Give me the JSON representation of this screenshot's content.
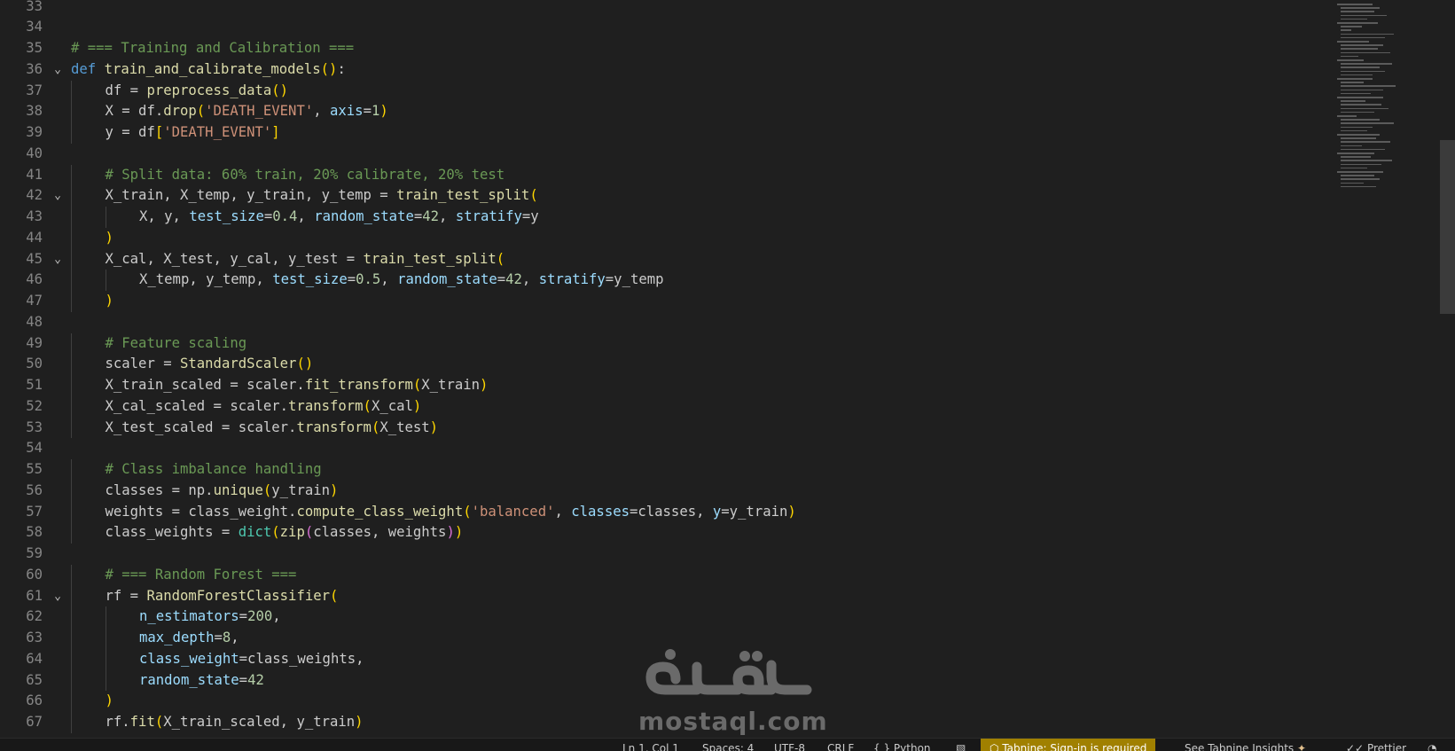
{
  "editor": {
    "lines": [
      {
        "n": "33",
        "fold": false,
        "indent": 0,
        "tokens": []
      },
      {
        "n": "34",
        "fold": false,
        "indent": 0,
        "tokens": []
      },
      {
        "n": "35",
        "fold": false,
        "indent": 0,
        "tokens": [
          [
            "cm",
            "# === Training and Calibration ==="
          ]
        ]
      },
      {
        "n": "36",
        "fold": true,
        "indent": 0,
        "tokens": [
          [
            "kw",
            "def"
          ],
          [
            "def",
            " "
          ],
          [
            "fn",
            "train_and_calibrate_models"
          ],
          [
            "b1",
            "()"
          ],
          [
            "def",
            ":"
          ]
        ]
      },
      {
        "n": "37",
        "fold": false,
        "indent": 1,
        "tokens": [
          [
            "def",
            "df = "
          ],
          [
            "fn",
            "preprocess_data"
          ],
          [
            "b1",
            "()"
          ]
        ]
      },
      {
        "n": "38",
        "fold": false,
        "indent": 1,
        "tokens": [
          [
            "def",
            "X = df."
          ],
          [
            "fn",
            "drop"
          ],
          [
            "b1",
            "("
          ],
          [
            "str",
            "'DEATH_EVENT'"
          ],
          [
            "def",
            ", "
          ],
          [
            "par",
            "axis"
          ],
          [
            "def",
            "="
          ],
          [
            "num",
            "1"
          ],
          [
            "b1",
            ")"
          ]
        ]
      },
      {
        "n": "39",
        "fold": false,
        "indent": 1,
        "tokens": [
          [
            "def",
            "y = df"
          ],
          [
            "b1",
            "["
          ],
          [
            "str",
            "'DEATH_EVENT'"
          ],
          [
            "b1",
            "]"
          ]
        ]
      },
      {
        "n": "40",
        "fold": false,
        "indent": 0,
        "tokens": []
      },
      {
        "n": "41",
        "fold": false,
        "indent": 1,
        "tokens": [
          [
            "cm",
            "# Split data: 60% train, 20% calibrate, 20% test"
          ]
        ]
      },
      {
        "n": "42",
        "fold": true,
        "indent": 1,
        "tokens": [
          [
            "def",
            "X_train, X_temp, y_train, y_temp = "
          ],
          [
            "fn",
            "train_test_split"
          ],
          [
            "b1",
            "("
          ]
        ]
      },
      {
        "n": "43",
        "fold": false,
        "indent": 2,
        "tokens": [
          [
            "def",
            "X, y, "
          ],
          [
            "par",
            "test_size"
          ],
          [
            "def",
            "="
          ],
          [
            "num",
            "0.4"
          ],
          [
            "def",
            ", "
          ],
          [
            "par",
            "random_state"
          ],
          [
            "def",
            "="
          ],
          [
            "num",
            "42"
          ],
          [
            "def",
            ", "
          ],
          [
            "par",
            "stratify"
          ],
          [
            "def",
            "=y"
          ]
        ]
      },
      {
        "n": "44",
        "fold": false,
        "indent": 1,
        "tokens": [
          [
            "b1",
            ")"
          ]
        ]
      },
      {
        "n": "45",
        "fold": true,
        "indent": 1,
        "tokens": [
          [
            "def",
            "X_cal, X_test, y_cal, y_test = "
          ],
          [
            "fn",
            "train_test_split"
          ],
          [
            "b1",
            "("
          ]
        ]
      },
      {
        "n": "46",
        "fold": false,
        "indent": 2,
        "tokens": [
          [
            "def",
            "X_temp, y_temp, "
          ],
          [
            "par",
            "test_size"
          ],
          [
            "def",
            "="
          ],
          [
            "num",
            "0.5"
          ],
          [
            "def",
            ", "
          ],
          [
            "par",
            "random_state"
          ],
          [
            "def",
            "="
          ],
          [
            "num",
            "42"
          ],
          [
            "def",
            ", "
          ],
          [
            "par",
            "stratify"
          ],
          [
            "def",
            "=y_temp"
          ]
        ]
      },
      {
        "n": "47",
        "fold": false,
        "indent": 1,
        "tokens": [
          [
            "b1",
            ")"
          ]
        ]
      },
      {
        "n": "48",
        "fold": false,
        "indent": 0,
        "tokens": []
      },
      {
        "n": "49",
        "fold": false,
        "indent": 1,
        "tokens": [
          [
            "cm",
            "# Feature scaling"
          ]
        ]
      },
      {
        "n": "50",
        "fold": false,
        "indent": 1,
        "tokens": [
          [
            "def",
            "scaler = "
          ],
          [
            "fn",
            "StandardScaler"
          ],
          [
            "b1",
            "()"
          ]
        ]
      },
      {
        "n": "51",
        "fold": false,
        "indent": 1,
        "tokens": [
          [
            "def",
            "X_train_scaled = scaler."
          ],
          [
            "fn",
            "fit_transform"
          ],
          [
            "b1",
            "("
          ],
          [
            "def",
            "X_train"
          ],
          [
            "b1",
            ")"
          ]
        ]
      },
      {
        "n": "52",
        "fold": false,
        "indent": 1,
        "tokens": [
          [
            "def",
            "X_cal_scaled = scaler."
          ],
          [
            "fn",
            "transform"
          ],
          [
            "b1",
            "("
          ],
          [
            "def",
            "X_cal"
          ],
          [
            "b1",
            ")"
          ]
        ]
      },
      {
        "n": "53",
        "fold": false,
        "indent": 1,
        "tokens": [
          [
            "def",
            "X_test_scaled = scaler."
          ],
          [
            "fn",
            "transform"
          ],
          [
            "b1",
            "("
          ],
          [
            "def",
            "X_test"
          ],
          [
            "b1",
            ")"
          ]
        ]
      },
      {
        "n": "54",
        "fold": false,
        "indent": 0,
        "tokens": []
      },
      {
        "n": "55",
        "fold": false,
        "indent": 1,
        "tokens": [
          [
            "cm",
            "# Class imbalance handling"
          ]
        ]
      },
      {
        "n": "56",
        "fold": false,
        "indent": 1,
        "tokens": [
          [
            "def",
            "classes = np."
          ],
          [
            "fn",
            "unique"
          ],
          [
            "b1",
            "("
          ],
          [
            "def",
            "y_train"
          ],
          [
            "b1",
            ")"
          ]
        ]
      },
      {
        "n": "57",
        "fold": false,
        "indent": 1,
        "tokens": [
          [
            "def",
            "weights = class_weight."
          ],
          [
            "fn",
            "compute_class_weight"
          ],
          [
            "b1",
            "("
          ],
          [
            "str",
            "'balanced'"
          ],
          [
            "def",
            ", "
          ],
          [
            "par",
            "classes"
          ],
          [
            "def",
            "=classes, "
          ],
          [
            "par",
            "y"
          ],
          [
            "def",
            "=y_train"
          ],
          [
            "b1",
            ")"
          ]
        ]
      },
      {
        "n": "58",
        "fold": false,
        "indent": 1,
        "tokens": [
          [
            "def",
            "class_weights = "
          ],
          [
            "bi",
            "dict"
          ],
          [
            "b1",
            "("
          ],
          [
            "fn",
            "zip"
          ],
          [
            "b2",
            "("
          ],
          [
            "def",
            "classes, weights"
          ],
          [
            "b2",
            ")"
          ],
          [
            "b1",
            ")"
          ]
        ]
      },
      {
        "n": "59",
        "fold": false,
        "indent": 0,
        "tokens": []
      },
      {
        "n": "60",
        "fold": false,
        "indent": 1,
        "tokens": [
          [
            "cm",
            "# === Random Forest ==="
          ]
        ]
      },
      {
        "n": "61",
        "fold": true,
        "indent": 1,
        "tokens": [
          [
            "def",
            "rf = "
          ],
          [
            "fn",
            "RandomForestClassifier"
          ],
          [
            "b1",
            "("
          ]
        ]
      },
      {
        "n": "62",
        "fold": false,
        "indent": 2,
        "tokens": [
          [
            "par",
            "n_estimators"
          ],
          [
            "def",
            "="
          ],
          [
            "num",
            "200"
          ],
          [
            "def",
            ","
          ]
        ]
      },
      {
        "n": "63",
        "fold": false,
        "indent": 2,
        "tokens": [
          [
            "par",
            "max_depth"
          ],
          [
            "def",
            "="
          ],
          [
            "num",
            "8"
          ],
          [
            "def",
            ","
          ]
        ]
      },
      {
        "n": "64",
        "fold": false,
        "indent": 2,
        "tokens": [
          [
            "par",
            "class_weight"
          ],
          [
            "def",
            "=class_weights,"
          ]
        ]
      },
      {
        "n": "65",
        "fold": false,
        "indent": 2,
        "tokens": [
          [
            "par",
            "random_state"
          ],
          [
            "def",
            "="
          ],
          [
            "num",
            "42"
          ]
        ]
      },
      {
        "n": "66",
        "fold": false,
        "indent": 1,
        "tokens": [
          [
            "b1",
            ")"
          ]
        ]
      },
      {
        "n": "67",
        "fold": false,
        "indent": 1,
        "tokens": [
          [
            "def",
            "rf."
          ],
          [
            "fn",
            "fit"
          ],
          [
            "b1",
            "("
          ],
          [
            "def",
            "X_train_scaled, y_train"
          ],
          [
            "b1",
            ")"
          ]
        ]
      }
    ]
  },
  "icons": {
    "fold": "chevron-down-icon"
  },
  "watermark": {
    "brand": "mostaql.com"
  },
  "statusbar": {
    "position": "Ln 1, Col 1",
    "spaces": "Spaces: 4",
    "encoding": "UTF-8",
    "eol": "CRLF",
    "language": "Python",
    "tabnine": "Tabnine: Sign-in is required",
    "tabnine_insights": "See Tabnine Insights",
    "prettier": "Prettier"
  },
  "colors": {
    "background": "#1f1f1f",
    "keyword": "#569cd6",
    "function": "#dcdcaa",
    "string": "#ce9178",
    "number": "#b5cea8",
    "comment": "#6a9955",
    "parameter": "#9cdcfe",
    "bracket1": "#ffd700",
    "bracket2": "#da70d6",
    "tabnine_badge": "#a08000"
  }
}
